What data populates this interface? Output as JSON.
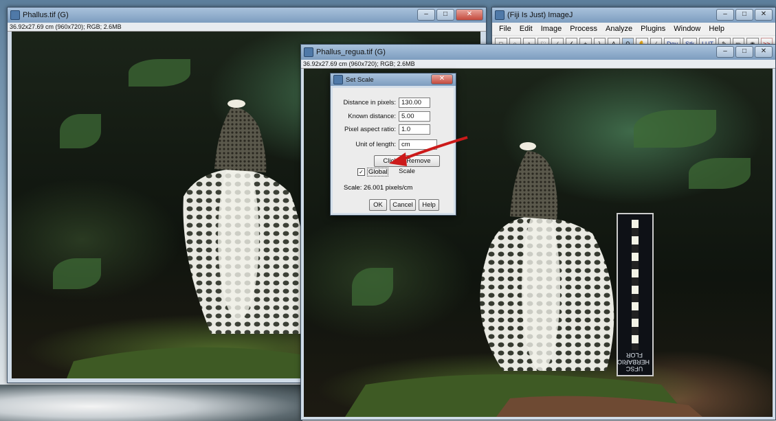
{
  "window_left": {
    "title": "Phallus.tif (G)",
    "info": "36.92x27.69 cm (960x720); RGB; 2.6MB"
  },
  "window_right": {
    "title": "Phallus_regua.tif (G)",
    "info": "36.92x27.69 cm (960x720); RGB; 2.6MB"
  },
  "main_window": {
    "title": "(Fiji Is Just) ImageJ",
    "menus": [
      "File",
      "Edit",
      "Image",
      "Process",
      "Analyze",
      "Plugins",
      "Window",
      "Help"
    ],
    "tools": [
      "rectangle-tool",
      "oval-tool",
      "polygon-tool",
      "freehand-tool",
      "line-tool",
      "angle-tool",
      "point-tool",
      "wand-tool",
      "text-tool",
      "magnifier-tool",
      "hand-tool",
      "dropper-tool"
    ],
    "text_tool": "A",
    "dev_label": "Dev",
    "stk_label": "Stk",
    "lut_label": "LUT",
    "more_label": ">>"
  },
  "dialog": {
    "title": "Set Scale",
    "distance_label": "Distance in pixels:",
    "distance_value": "130.00",
    "known_label": "Known distance:",
    "known_value": "5.00",
    "aspect_label": "Pixel aspect ratio:",
    "aspect_value": "1.0",
    "unit_label": "Unit of length:",
    "unit_value": "cm",
    "remove_button": "Click to Remove Scale",
    "global_label": "Global",
    "global_checked": true,
    "scale_text": "Scale: 26.001 pixels/cm",
    "ok": "OK",
    "cancel": "Cancel",
    "help": "Help"
  },
  "ruler_label": "UFSC HERBARIO FLOR",
  "colors": {
    "arrow": "#cc1a1a",
    "title_accent": "#7d9dbf"
  }
}
